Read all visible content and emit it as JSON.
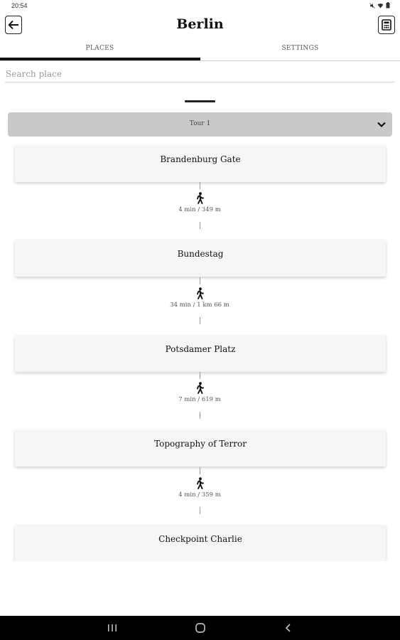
{
  "status": {
    "time": "20:54"
  },
  "header": {
    "title": "Berlin",
    "back_icon": "arrow-left-icon",
    "calc_icon": "calculator-icon"
  },
  "tabs": [
    {
      "label": "PLACES"
    },
    {
      "label": "SETTINGS"
    }
  ],
  "search": {
    "placeholder": "Search place",
    "value": ""
  },
  "tour": {
    "selected": "Tour 1"
  },
  "places": [
    {
      "name": "Brandenburg Gate"
    },
    {
      "name": "Bundestag"
    },
    {
      "name": "Potsdamer Platz"
    },
    {
      "name": "Topography of Terror"
    },
    {
      "name": "Checkpoint Charlie"
    }
  ],
  "legs": [
    {
      "text": "4 min / 349 m"
    },
    {
      "text": "34 min / 1 km 66 m"
    },
    {
      "text": "7 min / 619 m"
    },
    {
      "text": "4 min / 359 m"
    }
  ],
  "nav": {
    "recent_icon": "recent-apps-icon",
    "home_icon": "home-icon",
    "back_icon": "nav-back-icon"
  }
}
